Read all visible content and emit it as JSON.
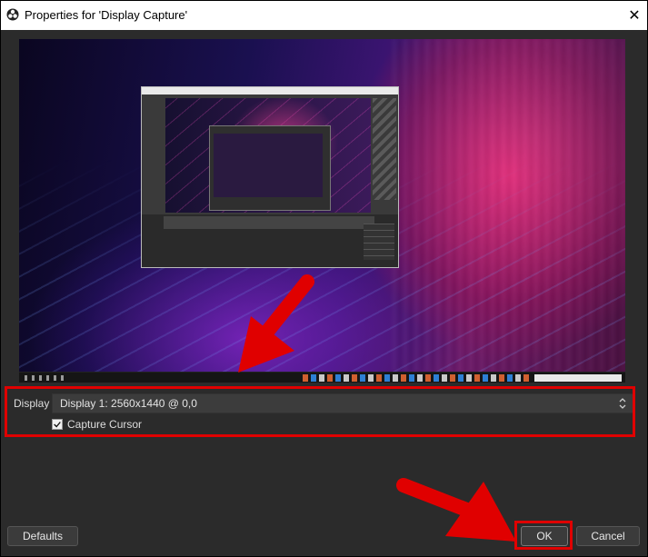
{
  "window": {
    "title": "Properties for 'Display Capture'",
    "close_glyph": "✕"
  },
  "form": {
    "display_label": "Display",
    "display_value": "Display 1: 2560x1440 @ 0,0",
    "capture_cursor_label": "Capture Cursor",
    "capture_cursor_checked": true
  },
  "buttons": {
    "defaults": "Defaults",
    "ok": "OK",
    "cancel": "Cancel"
  },
  "colors": {
    "annotation_red": "#e00000",
    "dialog_bg": "#2b2b2b"
  },
  "icons": {
    "app": "obs-logo-icon",
    "close": "close-icon",
    "checkbox": "checkmark-icon",
    "spin": "spin-arrows-icon"
  }
}
